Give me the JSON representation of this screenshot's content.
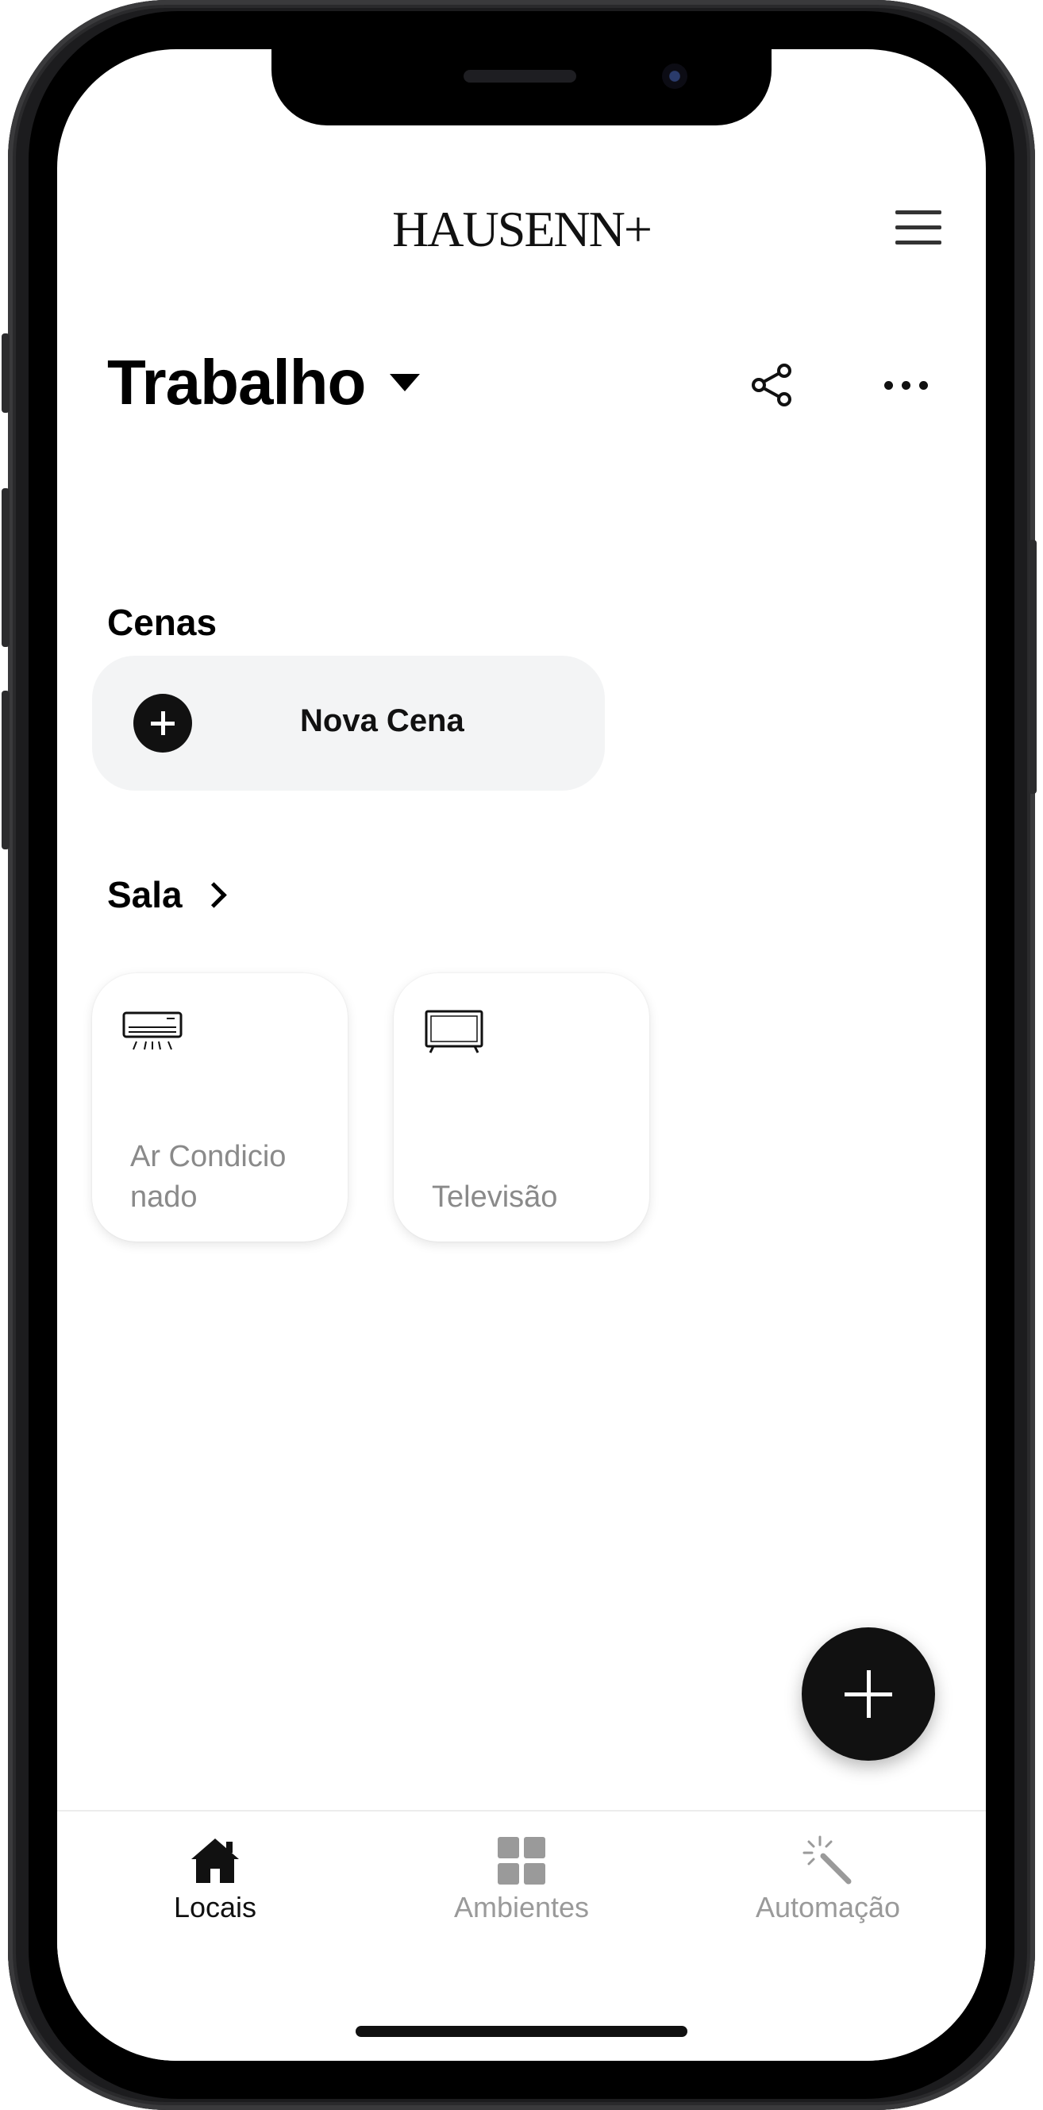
{
  "app": {
    "logo_text": "HAUSENN+"
  },
  "header": {
    "place_title": "Trabalho"
  },
  "scenes": {
    "section_label": "Cenas",
    "new_scene_label": "Nova Cena"
  },
  "room": {
    "name": "Sala",
    "devices": [
      {
        "label": "Ar Condicionado",
        "icon": "air-conditioner-icon"
      },
      {
        "label": "Televisão",
        "icon": "television-icon"
      }
    ]
  },
  "tabbar": {
    "tabs": [
      {
        "label": "Locais",
        "icon": "home-icon",
        "active": true
      },
      {
        "label": "Ambientes",
        "icon": "grid-icon",
        "active": false
      },
      {
        "label": "Automação",
        "icon": "magic-wand-icon",
        "active": false
      }
    ]
  },
  "colors": {
    "primary": "#111111",
    "inactive_tab": "#9a9a9a",
    "device_label": "#8a8a8a",
    "scene_card_bg": "#f3f4f5"
  }
}
